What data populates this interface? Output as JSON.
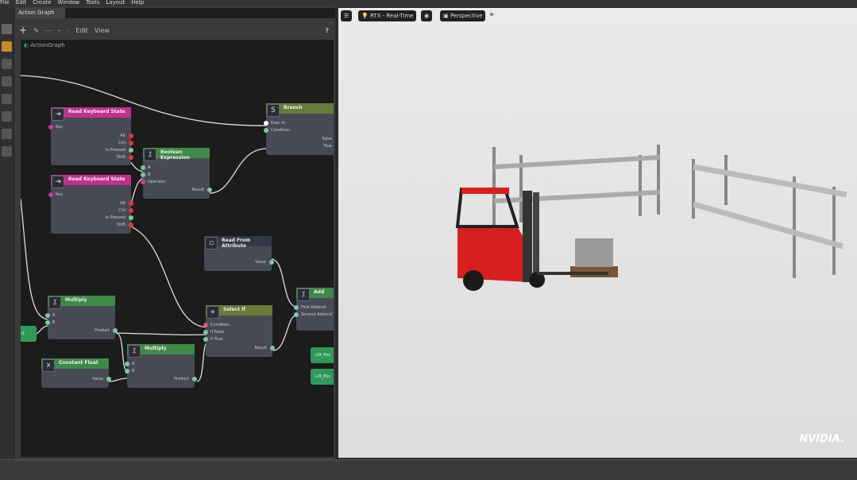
{
  "menu": [
    "File",
    "Edit",
    "Create",
    "Window",
    "Tools",
    "Layout",
    "Help"
  ],
  "panel": {
    "tab": "Action Graph",
    "edit": "Edit",
    "view": "View",
    "help": "?",
    "graph_name": "ActionGraph"
  },
  "nodes": {
    "rks1": {
      "title": "Read Keyboard State",
      "inputs": [
        "Key"
      ],
      "outputs": [
        "Alt",
        "Ctrl",
        "Is Pressed",
        "Shift"
      ]
    },
    "rks2": {
      "title": "Read Keyboard State",
      "inputs": [
        "Key"
      ],
      "outputs": [
        "Alt",
        "Ctrl",
        "Is Pressed",
        "Shift"
      ]
    },
    "bool": {
      "title": "Boolean Expression",
      "inputs": [
        "A",
        "B",
        "Operator"
      ],
      "outputs": [
        "Result"
      ]
    },
    "branch": {
      "title": "Branch",
      "inputs": [
        "Exec In",
        "Condition"
      ],
      "outputs": [
        "False",
        "True"
      ]
    },
    "rfa": {
      "title": "Read From Attribute",
      "inputs": [],
      "outputs": [
        "Value"
      ]
    },
    "mul1": {
      "title": "Multiply",
      "inputs": [
        "A",
        "B"
      ],
      "outputs": [
        "Product"
      ]
    },
    "cf": {
      "title": "Constant Float",
      "inputs": [],
      "outputs": [
        "Value"
      ]
    },
    "mul2": {
      "title": "Multiply",
      "inputs": [
        "A",
        "B"
      ],
      "outputs": [
        "Product"
      ]
    },
    "sel": {
      "title": "Select If",
      "inputs": [
        "Condition",
        "If False",
        "If True"
      ],
      "outputs": [
        "Result"
      ]
    },
    "add": {
      "title": "Add",
      "inputs": [
        "First Addend",
        "Second Addend"
      ],
      "outputs": []
    },
    "lift1": {
      "title": "Lift_Pos",
      "inputs": [],
      "outputs": []
    },
    "lift2": {
      "title": "Lift_Pos",
      "inputs": [],
      "outputs": []
    },
    "prod": {
      "title": "Product",
      "inputs": [],
      "outputs": []
    }
  },
  "viewport": {
    "renderer": "RTX - Real-Time",
    "camera": "Perspective"
  },
  "brand": "NVIDIA.",
  "colors": {
    "pink": "#c0308f",
    "green": "#3e8a48",
    "olive": "#6b7a3a",
    "exec": "#3aa16a"
  }
}
